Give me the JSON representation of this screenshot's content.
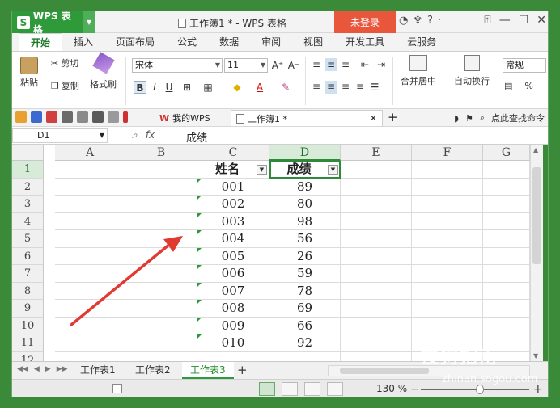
{
  "app": {
    "name": "WPS 表格",
    "window_title": "工作簿1 * - WPS 表格",
    "login_label": "未登录"
  },
  "menu": {
    "tabs": [
      "开始",
      "插入",
      "页面布局",
      "公式",
      "数据",
      "审阅",
      "视图",
      "开发工具",
      "云服务"
    ]
  },
  "ribbon": {
    "paste": "粘贴",
    "cut": "剪切",
    "copy": "复制",
    "format_painter": "格式刷",
    "font_name": "宋体",
    "font_size": "11",
    "merge_center": "合并居中",
    "wrap_text": "自动换行",
    "number_format": "常规",
    "percent": "%"
  },
  "quickbar": {
    "tab_mywps": "我的WPS",
    "tab_book": "工作簿1 *",
    "search": "点此查找命令"
  },
  "formula_bar": {
    "cell_ref": "D1",
    "content": "成绩"
  },
  "sheet": {
    "columns": [
      "A",
      "B",
      "C",
      "D",
      "E",
      "F",
      "G"
    ],
    "rows": [
      "1",
      "2",
      "3",
      "4",
      "5",
      "6",
      "7",
      "8",
      "9",
      "10",
      "11",
      "12"
    ],
    "header": {
      "name": "姓名",
      "score": "成绩"
    },
    "records": [
      {
        "name": "001",
        "score": "89"
      },
      {
        "name": "002",
        "score": "80"
      },
      {
        "name": "003",
        "score": "98"
      },
      {
        "name": "004",
        "score": "56"
      },
      {
        "name": "005",
        "score": "26"
      },
      {
        "name": "006",
        "score": "59"
      },
      {
        "name": "007",
        "score": "78"
      },
      {
        "name": "008",
        "score": "69"
      },
      {
        "name": "009",
        "score": "66"
      },
      {
        "name": "010",
        "score": "92"
      }
    ]
  },
  "sheet_tabs": [
    "工作表1",
    "工作表2",
    "工作表3"
  ],
  "status": {
    "zoom": "130 %"
  },
  "watermark": {
    "brand": "搜狗指南",
    "url": "zhinan.sogou.com"
  },
  "colors": {
    "accent": "#2e9a3a",
    "login": "#e8573b",
    "arrow": "#e03a32"
  }
}
